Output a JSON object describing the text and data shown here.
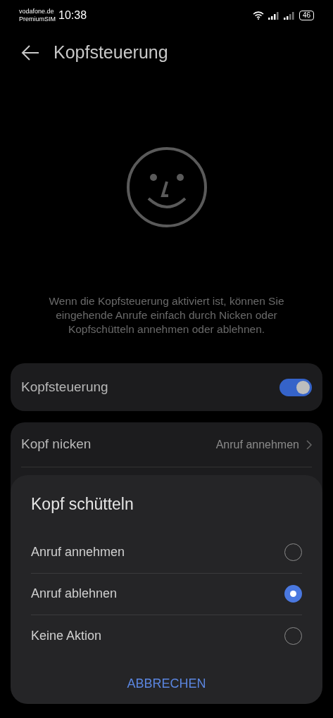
{
  "status_bar": {
    "carrier_line_1": "vodafone.de",
    "carrier_line_2": "PremiumSIM",
    "time": "10:38",
    "battery": "46"
  },
  "header": {
    "title": "Kopfsteuerung"
  },
  "description": "Wenn die Kopfsteuerung aktiviert ist, können Sie eingehende Anrufe einfach durch Nicken oder Kopfschütteln annehmen oder ablehnen.",
  "toggle_row": {
    "label": "Kopfsteuerung",
    "on": true
  },
  "settings": [
    {
      "label": "Kopf nicken",
      "value": "Anruf annehmen"
    }
  ],
  "dialog": {
    "title": "Kopf schütteln",
    "options": [
      {
        "label": "Anruf annehmen",
        "selected": false
      },
      {
        "label": "Anruf ablehnen",
        "selected": true
      },
      {
        "label": "Keine Aktion",
        "selected": false
      }
    ],
    "cancel": "ABBRECHEN"
  }
}
